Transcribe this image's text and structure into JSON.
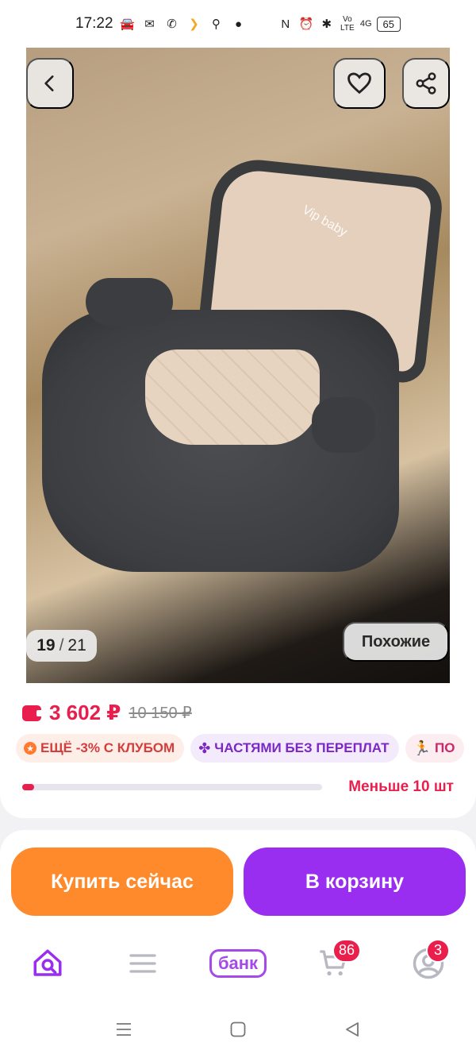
{
  "status": {
    "time": "17:22",
    "battery": "65",
    "network": "4G"
  },
  "gallery": {
    "counter_current": "19",
    "counter_sep": "/",
    "counter_total": "21",
    "similar_label": "Похожие",
    "brand_label": "Vip baby"
  },
  "product": {
    "price": "3 602 ₽",
    "old_price": "10 150 ₽",
    "chips": [
      {
        "label": "ЕЩЁ -3% С КЛУБОМ",
        "icon": "star-icon"
      },
      {
        "label": "ЧАСТЯМИ БЕЗ ПЕРЕПЛАТ",
        "icon": "clover-icon"
      },
      {
        "label": "ПО",
        "icon": "runner-icon"
      }
    ],
    "stock_text": "Меньше 10 шт",
    "stock_level": 0.04
  },
  "actions": {
    "buy_now": "Купить сейчас",
    "add_to_cart": "В корзину"
  },
  "nav": {
    "bank_label": "банк",
    "cart_badge": "86",
    "profile_badge": "3"
  },
  "colors": {
    "accent_pink": "#e91e4d",
    "accent_purple": "#9a2ef0",
    "accent_orange": "#ff8a2b"
  }
}
